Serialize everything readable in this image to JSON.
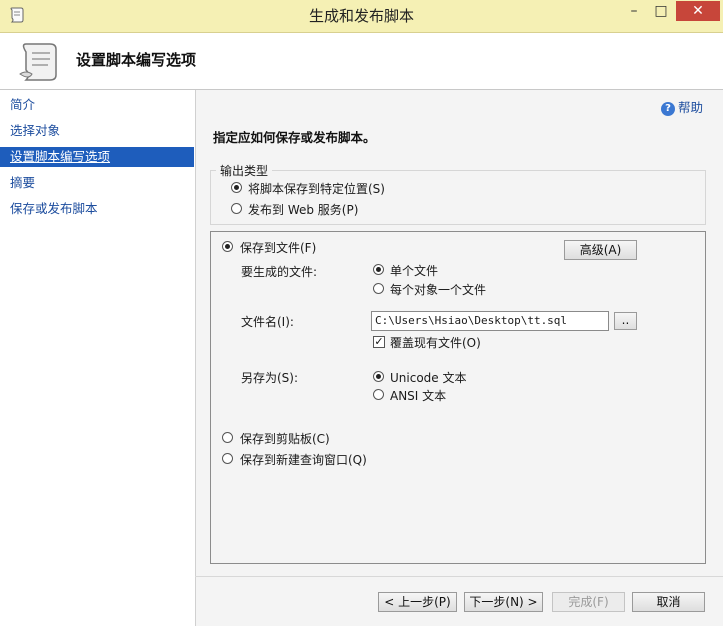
{
  "window": {
    "title": "生成和发布脚本",
    "minimize_glyph": "–",
    "maximize_glyph": "□",
    "close_glyph": "✕"
  },
  "header": {
    "title": "设置脚本编写选项",
    "icon": "scroll-icon"
  },
  "sidebar": {
    "items": [
      {
        "label": "简介",
        "selected": false
      },
      {
        "label": "选择对象",
        "selected": false
      },
      {
        "label": "设置脚本编写选项",
        "selected": true
      },
      {
        "label": "摘要",
        "selected": false
      },
      {
        "label": "保存或发布脚本",
        "selected": false
      }
    ]
  },
  "help": {
    "label": "帮助",
    "icon": "help-icon"
  },
  "instruction": "指定应如何保存或发布脚本。",
  "output_type": {
    "legend": "输出类型",
    "option_save": "将脚本保存到特定位置(S)",
    "option_web": "发布到 Web 服务(P)",
    "selected": "save"
  },
  "save_to_file": {
    "label": "保存到文件(F)",
    "advanced_button": "高级(A)",
    "files_label": "要生成的文件:",
    "single_file": "单个文件",
    "per_object": "每个对象一个文件",
    "filename_label": "文件名(I):",
    "filename_value": "C:\\Users\\Hsiao\\Desktop\\tt.sql",
    "browse_button": "..",
    "overwrite_label": "覆盖现有文件(O)",
    "overwrite_checked": true,
    "save_as_label": "另存为(S):",
    "unicode": "Unicode 文本",
    "ansi": "ANSI 文本"
  },
  "clipboard": "保存到剪贴板(C)",
  "query_window": "保存到新建查询窗口(Q)",
  "footer": {
    "prev": "< 上一步(P)",
    "next": "下一步(N) >",
    "finish": "完成(F)",
    "cancel": "取消"
  },
  "colors": {
    "titlebar": "#f5f0b4",
    "selection": "#1e5dbc",
    "close": "#c7463a"
  }
}
